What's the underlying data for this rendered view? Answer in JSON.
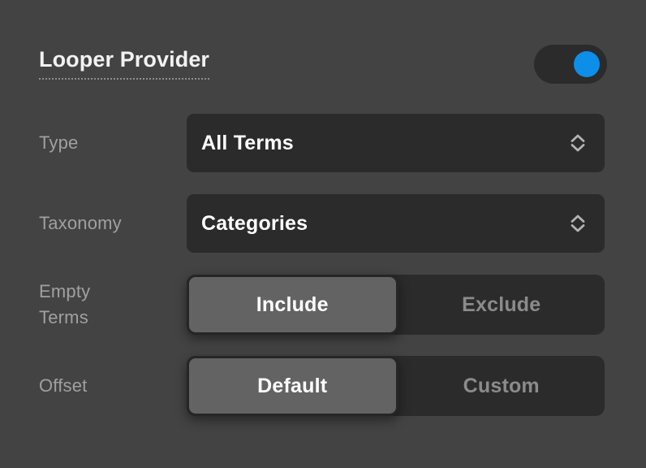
{
  "panel": {
    "title": "Looper Provider",
    "enabled_toggle": {
      "name": "looper-provider-enable-toggle",
      "state": "on",
      "accent_color": "#0d8ee9",
      "track_color": "#2b2b2b"
    },
    "background_color": "#434343"
  },
  "rows": [
    {
      "label": "Type",
      "label_lines": [
        "Type"
      ],
      "control": "select",
      "value": "All Terms",
      "icon": "chevron-up-down-icon"
    },
    {
      "label": "Taxonomy",
      "label_lines": [
        "Taxonomy"
      ],
      "control": "select",
      "value": "Categories",
      "icon": "chevron-up-down-icon"
    },
    {
      "label": "Empty Terms",
      "label_lines": [
        "Empty",
        "Terms"
      ],
      "control": "segmented",
      "options": [
        "Include",
        "Exclude"
      ],
      "selected": "Include"
    },
    {
      "label": "Offset",
      "label_lines": [
        "Offset"
      ],
      "control": "segmented",
      "options": [
        "Default",
        "Custom"
      ],
      "selected": "Default"
    }
  ],
  "colors": {
    "panel_bg": "#434343",
    "control_bg": "#2b2b2b",
    "selected_seg_bg": "#636363",
    "label_text": "#a0a0a0",
    "value_text": "#ffffff",
    "inactive_seg_text": "#8b8b8b",
    "accent": "#0d8ee9"
  }
}
